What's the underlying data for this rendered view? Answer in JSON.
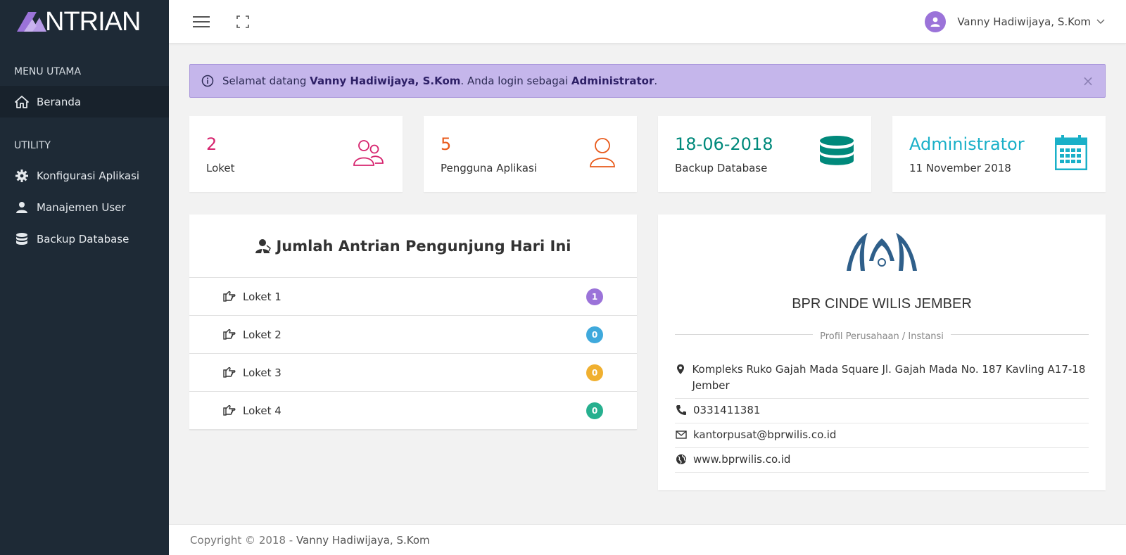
{
  "brand": {
    "logo_text": "NTRIAN"
  },
  "sidebar": {
    "sections": [
      {
        "header": "MENU UTAMA",
        "items": [
          {
            "label": "Beranda",
            "icon": "home-icon",
            "active": true
          }
        ]
      },
      {
        "header": "UTILITY",
        "items": [
          {
            "label": "Konfigurasi Aplikasi",
            "icon": "gear-icon"
          },
          {
            "label": "Manajemen User",
            "icon": "user-icon"
          },
          {
            "label": "Backup Database",
            "icon": "database-icon"
          }
        ]
      }
    ]
  },
  "topbar": {
    "user_name": "Vanny Hadiwijaya, S.Kom"
  },
  "alert": {
    "prefix": "Selamat datang ",
    "user": "Vanny Hadiwijaya, S.Kom",
    "middle": ". Anda login sebagai ",
    "role": "Administrator",
    "suffix": ".",
    "close": "×"
  },
  "stats": [
    {
      "value": "2",
      "label": "Loket",
      "color": "#d6246e",
      "icon": "users-icon"
    },
    {
      "value": "5",
      "label": "Pengguna Aplikasi",
      "color": "#e8591a",
      "icon": "user-outline-icon"
    },
    {
      "value": "18-06-2018",
      "label": "Backup Database",
      "color": "#00897b",
      "icon": "database-icon"
    },
    {
      "value": "Administrator",
      "label": "11 November 2018",
      "color": "#1ab0c8",
      "icon": "calendar-icon"
    }
  ],
  "queue": {
    "title": "Jumlah Antrian Pengunjung Hari Ini",
    "rows": [
      {
        "label": "Loket 1",
        "count": "1",
        "color": "#9b73d9"
      },
      {
        "label": "Loket 2",
        "count": "0",
        "color": "#3fa9dc"
      },
      {
        "label": "Loket 3",
        "count": "0",
        "color": "#f0b030"
      },
      {
        "label": "Loket 4",
        "count": "0",
        "color": "#26b08f"
      }
    ]
  },
  "profile": {
    "company": "BPR CINDE WILIS JEMBER",
    "section_label": "Profil Perusahaan / Instansi",
    "address": "Kompleks Ruko Gajah Mada Square Jl. Gajah Mada No. 187 Kavling A17-18 Jember",
    "phone": "0331411381",
    "email": "kantorpusat@bprwilis.co.id",
    "website": "www.bprwilis.co.id"
  },
  "footer": {
    "copyright": "Copyright © 2018 - ",
    "author": "Vanny Hadiwijaya, S.Kom"
  },
  "colors": {
    "sidebar": "#1e2a36",
    "alert_bg": "#c5b6eb",
    "logo_blue": "#2f5f8a"
  }
}
